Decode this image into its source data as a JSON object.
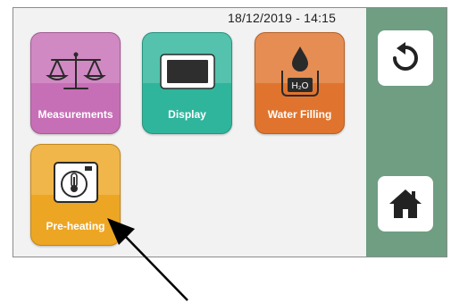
{
  "status": {
    "datetime": "18/12/2019 - 14:15"
  },
  "tiles": [
    {
      "label": "Measurements",
      "icon": "scale-icon",
      "color": "#c76fb6"
    },
    {
      "label": "Display",
      "icon": "display-icon",
      "color": "#2fb59c"
    },
    {
      "label": "Water Filling",
      "icon": "water-drop-icon",
      "icon_text": "H₂O",
      "color": "#e0742e"
    },
    {
      "label": "Pre-heating",
      "icon": "thermometer-icon",
      "color": "#eda623"
    }
  ],
  "sidebar": {
    "color": "#6f9e82",
    "buttons": [
      {
        "icon": "back-arrow-icon"
      },
      {
        "icon": "home-icon"
      }
    ]
  }
}
